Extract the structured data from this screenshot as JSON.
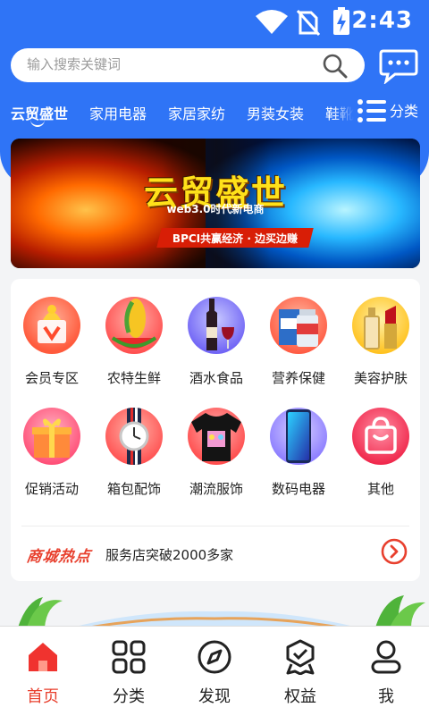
{
  "status_bar": {
    "time": "2:43"
  },
  "search": {
    "placeholder": "输入搜索关键词"
  },
  "categories": [
    "云贸盛世",
    "家用电器",
    "家居家纺",
    "男装女装",
    "鞋靴"
  ],
  "more_label": "分类",
  "banner": {
    "title": "云贸盛世",
    "subtitle": "web3.0时代新电商",
    "ribbon": "BPCI共赢经济 · 边买边赚"
  },
  "grid": [
    {
      "label": "会员专区",
      "icon": "vip-gift-icon"
    },
    {
      "label": "农特生鲜",
      "icon": "corn-watermelon-icon"
    },
    {
      "label": "酒水食品",
      "icon": "wine-bottle-icon"
    },
    {
      "label": "营养保健",
      "icon": "supplement-box-icon"
    },
    {
      "label": "美容护肤",
      "icon": "lipstick-icon"
    },
    {
      "label": "促销活动",
      "icon": "gift-box-icon"
    },
    {
      "label": "箱包配饰",
      "icon": "watch-icon"
    },
    {
      "label": "潮流服饰",
      "icon": "tshirt-icon"
    },
    {
      "label": "数码电器",
      "icon": "smartphone-icon"
    },
    {
      "label": "其他",
      "icon": "shopping-bag-icon"
    }
  ],
  "hot": {
    "logo": "商城热点",
    "text": "服务店突破2000多家"
  },
  "tabs": [
    {
      "label": "首页",
      "icon": "home-icon",
      "active": true
    },
    {
      "label": "分类",
      "icon": "grid-icon",
      "active": false
    },
    {
      "label": "发现",
      "icon": "compass-icon",
      "active": false
    },
    {
      "label": "权益",
      "icon": "badge-icon",
      "active": false
    },
    {
      "label": "我",
      "icon": "user-icon",
      "active": false
    }
  ],
  "colors": {
    "primary": "#2f74f6",
    "accent": "#e8402e"
  }
}
